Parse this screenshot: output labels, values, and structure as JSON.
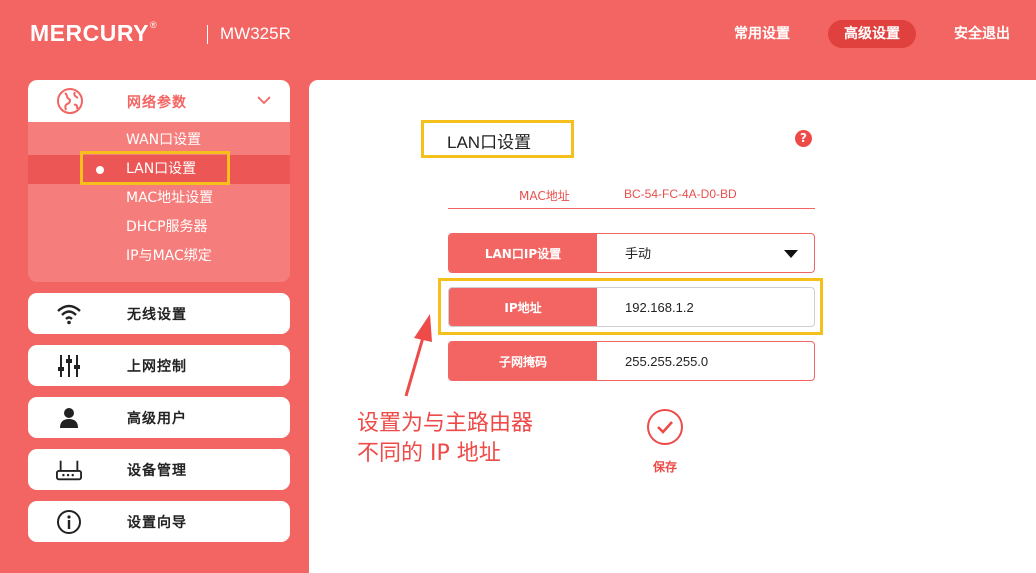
{
  "header": {
    "brand": "MERCURY",
    "model": "MW325R",
    "nav": [
      {
        "label": "常用设置"
      },
      {
        "label": "高级设置"
      },
      {
        "label": "安全退出"
      }
    ]
  },
  "sidebar": {
    "network": {
      "label": "网络参数",
      "items": [
        {
          "label": "WAN口设置"
        },
        {
          "label": "LAN口设置"
        },
        {
          "label": "MAC地址设置"
        },
        {
          "label": "DHCP服务器"
        },
        {
          "label": "IP与MAC绑定"
        }
      ]
    },
    "items": [
      {
        "label": "无线设置",
        "icon": "wifi-icon"
      },
      {
        "label": "上网控制",
        "icon": "sliders-icon"
      },
      {
        "label": "高级用户",
        "icon": "user-icon"
      },
      {
        "label": "设备管理",
        "icon": "router-icon"
      },
      {
        "label": "设置向导",
        "icon": "info-icon"
      }
    ]
  },
  "main": {
    "title": "LAN口设置",
    "help": "?",
    "mac_label": "MAC地址",
    "mac_value": "BC-54-FC-4A-D0-BD",
    "ip_mode_label": "LAN口IP设置",
    "ip_mode_value": "手动",
    "ip_label": "IP地址",
    "ip_value": "192.168.1.2",
    "mask_label": "子网掩码",
    "mask_value": "255.255.255.0",
    "save_label": "保存",
    "annotation_line1": "设置为与主路由器",
    "annotation_line2": "不同的 IP 地址"
  },
  "colors": {
    "accent": "#f36563",
    "highlight": "#f5bf1c"
  }
}
